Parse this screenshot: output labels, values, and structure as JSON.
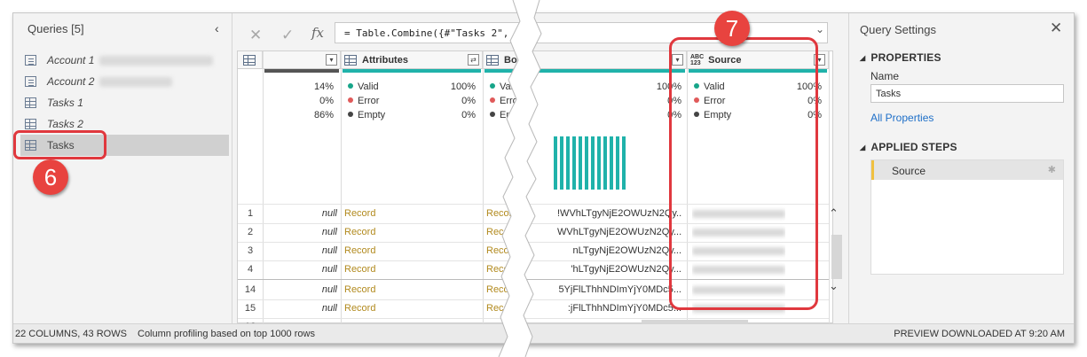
{
  "queries_pane": {
    "title": "Queries [5]",
    "items": [
      {
        "label": "Account 1",
        "kind": "param",
        "italic": true
      },
      {
        "label": "Account 2",
        "kind": "param",
        "italic": true
      },
      {
        "label": "Tasks 1",
        "kind": "table",
        "italic": true
      },
      {
        "label": "Tasks 2",
        "kind": "table",
        "italic": true
      },
      {
        "label": "Tasks",
        "kind": "table",
        "italic": false,
        "selected": true
      }
    ]
  },
  "callouts": {
    "left": "6",
    "right": "7"
  },
  "formula_bar": {
    "cancel_icon": "close-icon",
    "commit_icon": "check-icon",
    "fx_label": "fx",
    "formula": "= Table.Combine({#\"Tasks 2\","
  },
  "columns": [
    {
      "name": "",
      "type_icon": "table-icon"
    },
    {
      "name": "Attributes",
      "type_icon": "table-icon"
    },
    {
      "name": "Bo",
      "type_icon": "table-icon"
    },
    {
      "name": "Source",
      "type_icon": "abc-123-icon"
    }
  ],
  "type_icon_text": {
    "abc": "ABC",
    "num": "123"
  },
  "stats": {
    "first": [
      "14%",
      "0%",
      "86%"
    ],
    "labels": {
      "valid": "Valid",
      "error": "Error",
      "empty": "Empty"
    },
    "attributes": [
      "100%",
      "0%",
      "0%"
    ],
    "bo_partial": [
      "Vali",
      "Erro",
      "Emp"
    ],
    "bo_pct": [
      "100%",
      "0%",
      "0%"
    ],
    "source": [
      "100%",
      "0%",
      "0%"
    ]
  },
  "rows": [
    {
      "num": "1",
      "first": "null",
      "attr": "Record",
      "bo": "Record",
      "hash": "!WVhLTgyNjE2OWUzN2Qy..."
    },
    {
      "num": "2",
      "first": "null",
      "attr": "Record",
      "bo": "Record",
      "hash": "WVhLTgyNjE2OWUzN2Qy..."
    },
    {
      "num": "3",
      "first": "null",
      "attr": "Record",
      "bo": "Record",
      "hash": "nLTgyNjE2OWUzN2Qy..."
    },
    {
      "num": "4",
      "first": "null",
      "attr": "Record",
      "bo": "Record",
      "hash": "'hLTgyNjE2OWUzN2Qy..."
    },
    {
      "num": "14",
      "first": "null",
      "attr": "Record",
      "bo": "Record",
      "hash": "5YjFlLThhNDImYjY0MDc5..."
    },
    {
      "num": "15",
      "first": "null",
      "attr": "Record",
      "bo": "Record",
      "hash": ":jFlLThhNDImYjY0MDc5..."
    },
    {
      "num": "16",
      "first": "",
      "attr": "",
      "bo": "",
      "hash": ""
    }
  ],
  "query_settings": {
    "title": "Query Settings",
    "properties_header": "PROPERTIES",
    "name_label": "Name",
    "name_value": "Tasks",
    "all_properties_link": "All Properties",
    "applied_steps_header": "APPLIED STEPS",
    "steps": [
      "Source"
    ]
  },
  "status_bar": {
    "columns_rows": "22 COLUMNS, 43 ROWS",
    "profiling": "Column profiling based on top 1000 rows",
    "preview": "PREVIEW DOWNLOADED AT 9:20 AM"
  },
  "colors": {
    "accent_teal": "#20b2aa",
    "callout_red": "#e0383e",
    "record_gold": "#b28a1e",
    "link_blue": "#1e6fc8"
  }
}
